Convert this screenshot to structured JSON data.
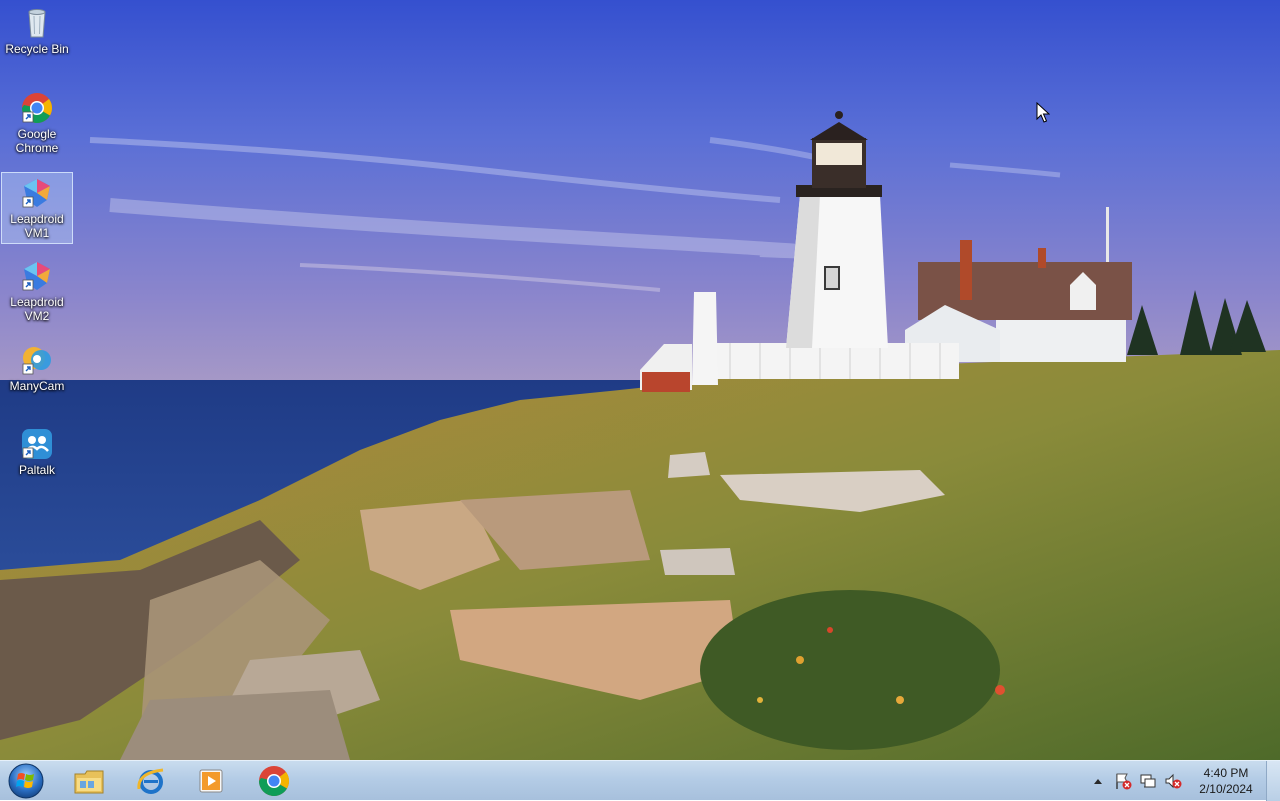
{
  "desktop": {
    "icons": [
      {
        "label": "Recycle Bin",
        "icon": "recycle-bin-icon"
      },
      {
        "label": "Google Chrome",
        "icon": "chrome-icon"
      },
      {
        "label": "Leapdroid VM1",
        "icon": "leapdroid-icon",
        "selected": true
      },
      {
        "label": "Leapdroid VM2",
        "icon": "leapdroid-icon"
      },
      {
        "label": "ManyCam",
        "icon": "manycam-icon"
      },
      {
        "label": "Paltalk",
        "icon": "paltalk-icon"
      }
    ],
    "wallpaper": "lighthouse-on-rocky-coast"
  },
  "taskbar": {
    "pinned": [
      {
        "icon": "file-explorer-icon"
      },
      {
        "icon": "internet-explorer-icon"
      },
      {
        "icon": "media-player-icon"
      },
      {
        "icon": "chrome-icon"
      }
    ],
    "tray": [
      "show-hidden-icons-icon",
      "action-center-flag-icon",
      "network-icon",
      "volume-muted-icon"
    ],
    "clock": {
      "time": "4:40 PM",
      "date": "2/10/2024"
    }
  },
  "colors": {
    "sky": "#4a63d6",
    "taskbar": "#b9cfe6",
    "selection": "#cfe3ff"
  }
}
